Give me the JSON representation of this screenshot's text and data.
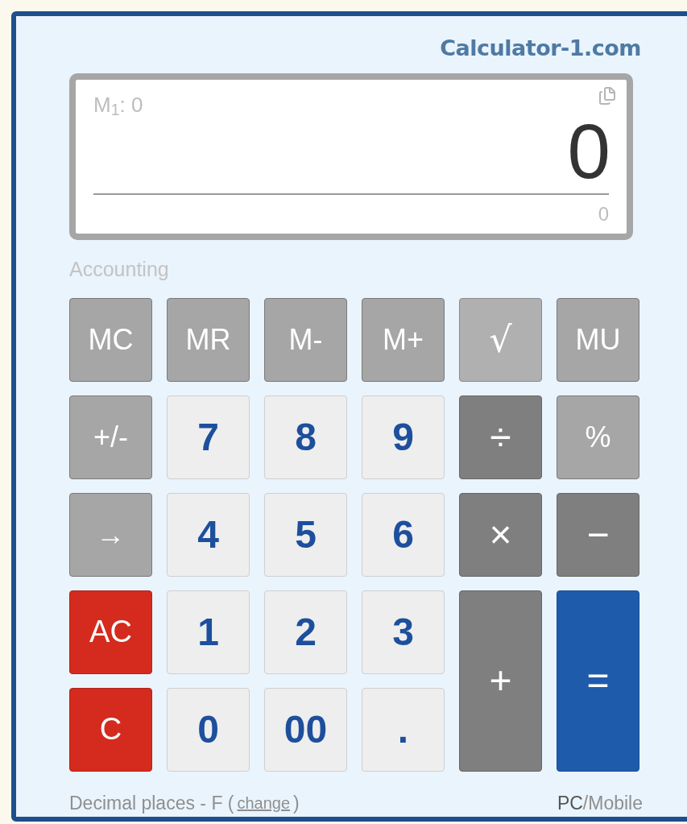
{
  "site_title": "Calculator-1.com",
  "display": {
    "memory": "M$_{1}$: 0",
    "value": "0",
    "subtotal": "0"
  },
  "mode": "Accounting",
  "keys": [
    {
      "label": "MC",
      "kind": "memory",
      "tall": false
    },
    {
      "label": "MR",
      "kind": "memory",
      "tall": false
    },
    {
      "label": "M-",
      "kind": "memory",
      "tall": false
    },
    {
      "label": "M+",
      "kind": "memory",
      "tall": false
    },
    {
      "label": "√",
      "kind": "root",
      "tall": false
    },
    {
      "label": "MU",
      "kind": "memory",
      "tall": false
    },
    {
      "label": "+/-",
      "kind": "memory",
      "tall": false
    },
    {
      "label": "7",
      "kind": "digit",
      "tall": false
    },
    {
      "label": "8",
      "kind": "digit",
      "tall": false
    },
    {
      "label": "9",
      "kind": "digit",
      "tall": false
    },
    {
      "label": "÷",
      "kind": "operator",
      "tall": false
    },
    {
      "label": "%",
      "kind": "memory",
      "tall": false
    },
    {
      "label": "→",
      "kind": "memory",
      "tall": false
    },
    {
      "label": "4",
      "kind": "digit",
      "tall": false
    },
    {
      "label": "5",
      "kind": "digit",
      "tall": false
    },
    {
      "label": "6",
      "kind": "digit",
      "tall": false
    },
    {
      "label": "×",
      "kind": "operator",
      "tall": false
    },
    {
      "label": "−",
      "kind": "operator",
      "tall": false
    },
    {
      "label": "AC",
      "kind": "clear",
      "tall": false
    },
    {
      "label": "1",
      "kind": "digit",
      "tall": false
    },
    {
      "label": "2",
      "kind": "digit",
      "tall": false
    },
    {
      "label": "3",
      "kind": "digit",
      "tall": false
    },
    {
      "label": "+",
      "kind": "operator",
      "tall": true
    },
    {
      "label": "=",
      "kind": "equals",
      "tall": true
    },
    {
      "label": "C",
      "kind": "clear",
      "tall": false
    },
    {
      "label": "0",
      "kind": "digit",
      "tall": false
    },
    {
      "label": "00",
      "kind": "digit",
      "tall": false
    },
    {
      "label": ".",
      "kind": "digit",
      "tall": false
    }
  ],
  "footer": {
    "decimal_text": "Decimal places - F (",
    "change_link": "change",
    "decimal_close": ")",
    "platforms": [
      {
        "label": "PC",
        "selected": true
      },
      {
        "label": "Mobile",
        "selected": false
      }
    ],
    "separator": "/"
  }
}
